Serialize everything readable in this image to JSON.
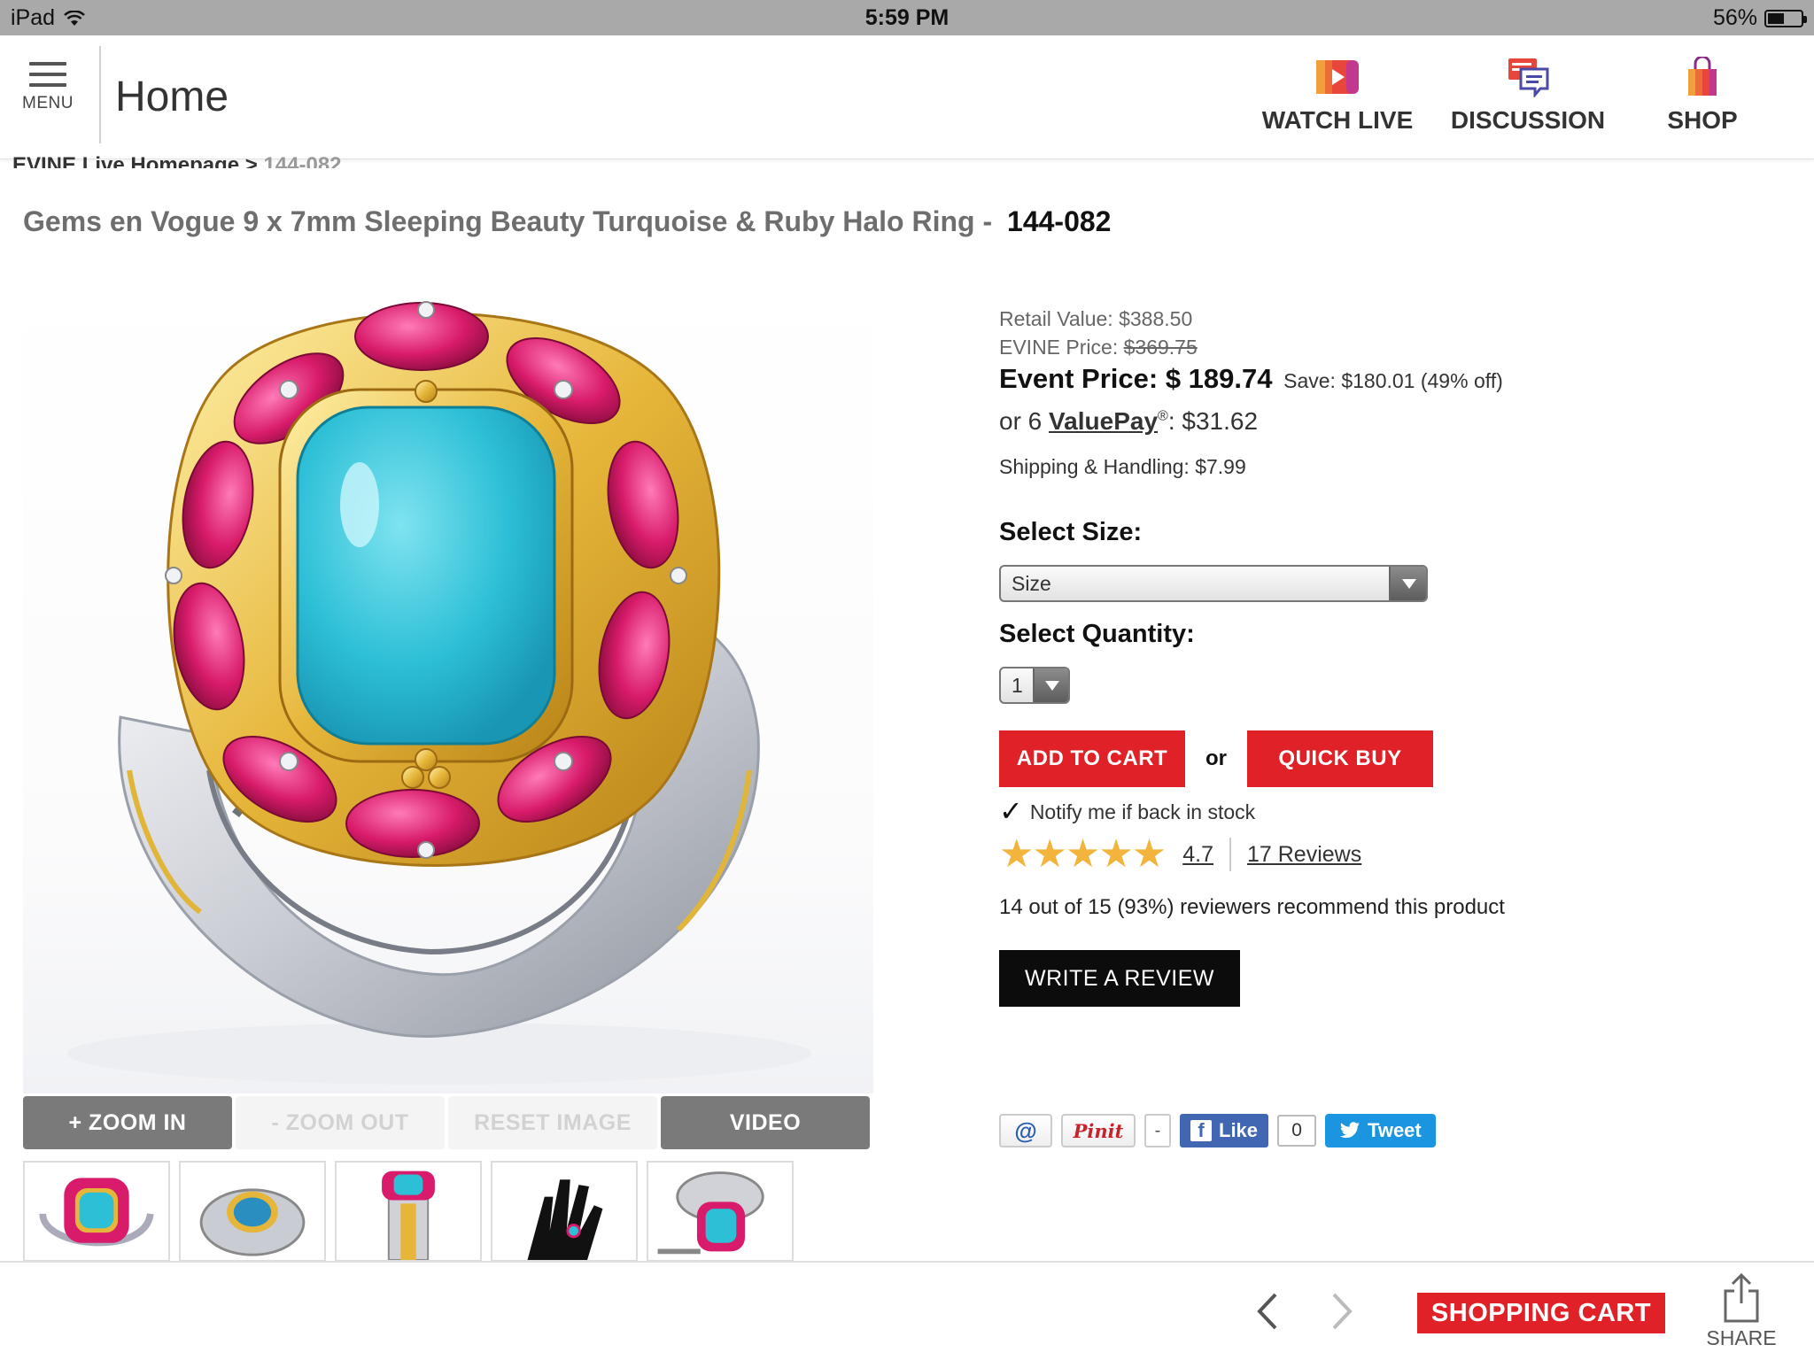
{
  "status_bar": {
    "device": "iPad",
    "time": "5:59 PM",
    "battery": "56%",
    "battery_level": 0.56
  },
  "header": {
    "menu_label": "MENU",
    "title": "Home",
    "nav": [
      {
        "label": "WATCH LIVE",
        "icon": "play-tv-icon"
      },
      {
        "label": "DISCUSSION",
        "icon": "chat-bubbles-icon"
      },
      {
        "label": "SHOP",
        "icon": "shopping-bag-icon"
      }
    ]
  },
  "breadcrumb": {
    "parent": "EVINE Live Homepage >",
    "current": "144-082"
  },
  "product": {
    "title": "Gems en Vogue 9 x 7mm Sleeping Beauty Turquoise & Ruby Halo Ring -",
    "sku": "144-082"
  },
  "image_controls": [
    "+ ZOOM IN",
    "- ZOOM OUT",
    "RESET IMAGE",
    "VIDEO"
  ],
  "thumbnails": [
    "ring-front-thumbnail",
    "ring-side-thumbnail",
    "ring-profile-thumbnail",
    "ring-on-hand-thumbnail",
    "ring-angle-thumbnail"
  ],
  "pricing": {
    "retail_label": "Retail Value:",
    "retail_value": "$388.50",
    "evine_label": "EVINE Price:",
    "evine_value": "$369.75",
    "event_label": "Event Price:",
    "event_value": "$ 189.74",
    "save_text": "Save: $180.01 (49% off)",
    "valuepay_prefix": "or  6",
    "valuepay_label": "ValuePay",
    "valuepay_mark": "®",
    "valuepay_amount": ": $31.62",
    "shipping": "Shipping & Handling: $7.99"
  },
  "options": {
    "size_label": "Select Size:",
    "size_value": "Size",
    "qty_label": "Select Quantity:",
    "qty_value": "1"
  },
  "actions": {
    "add_to_cart": "ADD TO CART",
    "or": "or",
    "quick_buy": "QUICK BUY",
    "notify_check": "✓",
    "notify": "Notify me if back in stock",
    "write_review": "WRITE A REVIEW"
  },
  "rating": {
    "stars": "★★★★★",
    "value": "4.7",
    "reviews": "17 Reviews",
    "recommend": "14 out of 15 (93%) reviewers recommend this product"
  },
  "social": {
    "email": "@",
    "pin": "Pinit",
    "pin_count": "-",
    "like": "Like",
    "like_count": "0",
    "tweet": "Tweet"
  },
  "toolbar": {
    "cart": "SHOPPING CART",
    "share": "SHARE"
  },
  "colors": {
    "accent_red": "#e02127",
    "star": "#f2b43c",
    "facebook": "#4267b2",
    "twitter": "#1b95e0",
    "status_bar": "#a9a9a9"
  }
}
